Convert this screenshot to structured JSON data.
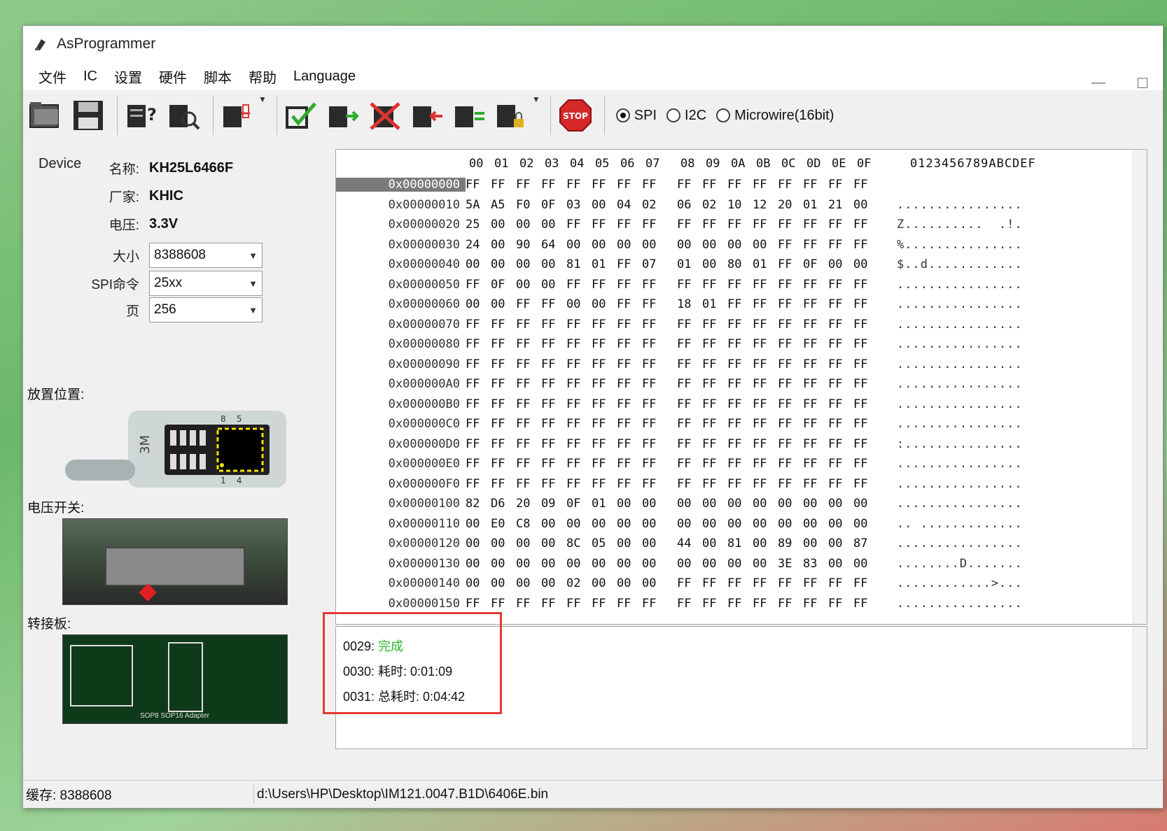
{
  "window": {
    "title": "AsProgrammer"
  },
  "menu": [
    "文件",
    "IC",
    "设置",
    "硬件",
    "脚本",
    "帮助",
    "Language"
  ],
  "toolbar": {
    "buttons": [
      "open-icon",
      "save-icon",
      "read-id-icon",
      "search-icon",
      "config-icon",
      "verify-icon",
      "read-icon",
      "erase-icon",
      "write-icon",
      "compare-icon",
      "lock-icon",
      "stop-icon"
    ],
    "stop_label": "STOP",
    "protocols": [
      {
        "label": "SPI",
        "selected": true
      },
      {
        "label": "I2C",
        "selected": false
      },
      {
        "label": "Microwire(16bit)",
        "selected": false
      }
    ]
  },
  "device": {
    "section_label": "Device",
    "name_label": "名称:",
    "name": "KH25L6466F",
    "vendor_label": "厂家:",
    "vendor": "KHIC",
    "voltage_label": "电压:",
    "voltage": "3.3V",
    "size_label": "大小",
    "size": "8388608",
    "spi_cmd_label": "SPI命令",
    "spi_cmd": "25xx",
    "page_label": "页",
    "page": "256"
  },
  "sections": {
    "placement": "放置位置:",
    "voltage_switch": "电压开关:",
    "adapter": "转接板:"
  },
  "chip_panel": {
    "pin_top": "8    5",
    "pin_bottom": "1    4",
    "text": "3M"
  },
  "photos": {
    "adapter_text": "SOP8  SOP16  Adapter"
  },
  "hex": {
    "header": [
      "00",
      "01",
      "02",
      "03",
      "04",
      "05",
      "06",
      "07",
      "08",
      "09",
      "0A",
      "0B",
      "0C",
      "0D",
      "0E",
      "0F"
    ],
    "ascii_header": "0123456789ABCDEF",
    "rows": [
      {
        "addr": "0x00000000",
        "bytes": [
          "FF",
          "FF",
          "FF",
          "FF",
          "FF",
          "FF",
          "FF",
          "FF",
          "FF",
          "FF",
          "FF",
          "FF",
          "FF",
          "FF",
          "FF",
          "FF"
        ],
        "ascii": ""
      },
      {
        "addr": "0x00000010",
        "bytes": [
          "5A",
          "A5",
          "F0",
          "0F",
          "03",
          "00",
          "04",
          "02",
          "06",
          "02",
          "10",
          "12",
          "20",
          "01",
          "21",
          "00"
        ],
        "ascii": "................"
      },
      {
        "addr": "0x00000020",
        "bytes": [
          "25",
          "00",
          "00",
          "00",
          "FF",
          "FF",
          "FF",
          "FF",
          "FF",
          "FF",
          "FF",
          "FF",
          "FF",
          "FF",
          "FF",
          "FF"
        ],
        "ascii": "Z..........  .!."
      },
      {
        "addr": "0x00000030",
        "bytes": [
          "24",
          "00",
          "90",
          "64",
          "00",
          "00",
          "00",
          "00",
          "00",
          "00",
          "00",
          "00",
          "FF",
          "FF",
          "FF",
          "FF"
        ],
        "ascii": "%..............."
      },
      {
        "addr": "0x00000040",
        "bytes": [
          "00",
          "00",
          "00",
          "00",
          "81",
          "01",
          "FF",
          "07",
          "01",
          "00",
          "80",
          "01",
          "FF",
          "0F",
          "00",
          "00"
        ],
        "ascii": "$..d............"
      },
      {
        "addr": "0x00000050",
        "bytes": [
          "FF",
          "0F",
          "00",
          "00",
          "FF",
          "FF",
          "FF",
          "FF",
          "FF",
          "FF",
          "FF",
          "FF",
          "FF",
          "FF",
          "FF",
          "FF"
        ],
        "ascii": "................"
      },
      {
        "addr": "0x00000060",
        "bytes": [
          "00",
          "00",
          "FF",
          "FF",
          "00",
          "00",
          "FF",
          "FF",
          "18",
          "01",
          "FF",
          "FF",
          "FF",
          "FF",
          "FF",
          "FF"
        ],
        "ascii": "................"
      },
      {
        "addr": "0x00000070",
        "bytes": [
          "FF",
          "FF",
          "FF",
          "FF",
          "FF",
          "FF",
          "FF",
          "FF",
          "FF",
          "FF",
          "FF",
          "FF",
          "FF",
          "FF",
          "FF",
          "FF"
        ],
        "ascii": "................"
      },
      {
        "addr": "0x00000080",
        "bytes": [
          "FF",
          "FF",
          "FF",
          "FF",
          "FF",
          "FF",
          "FF",
          "FF",
          "FF",
          "FF",
          "FF",
          "FF",
          "FF",
          "FF",
          "FF",
          "FF"
        ],
        "ascii": "................"
      },
      {
        "addr": "0x00000090",
        "bytes": [
          "FF",
          "FF",
          "FF",
          "FF",
          "FF",
          "FF",
          "FF",
          "FF",
          "FF",
          "FF",
          "FF",
          "FF",
          "FF",
          "FF",
          "FF",
          "FF"
        ],
        "ascii": "................"
      },
      {
        "addr": "0x000000A0",
        "bytes": [
          "FF",
          "FF",
          "FF",
          "FF",
          "FF",
          "FF",
          "FF",
          "FF",
          "FF",
          "FF",
          "FF",
          "FF",
          "FF",
          "FF",
          "FF",
          "FF"
        ],
        "ascii": "................"
      },
      {
        "addr": "0x000000B0",
        "bytes": [
          "FF",
          "FF",
          "FF",
          "FF",
          "FF",
          "FF",
          "FF",
          "FF",
          "FF",
          "FF",
          "FF",
          "FF",
          "FF",
          "FF",
          "FF",
          "FF"
        ],
        "ascii": "................"
      },
      {
        "addr": "0x000000C0",
        "bytes": [
          "FF",
          "FF",
          "FF",
          "FF",
          "FF",
          "FF",
          "FF",
          "FF",
          "FF",
          "FF",
          "FF",
          "FF",
          "FF",
          "FF",
          "FF",
          "FF"
        ],
        "ascii": "................"
      },
      {
        "addr": "0x000000D0",
        "bytes": [
          "FF",
          "FF",
          "FF",
          "FF",
          "FF",
          "FF",
          "FF",
          "FF",
          "FF",
          "FF",
          "FF",
          "FF",
          "FF",
          "FF",
          "FF",
          "FF"
        ],
        "ascii": ":..............."
      },
      {
        "addr": "0x000000E0",
        "bytes": [
          "FF",
          "FF",
          "FF",
          "FF",
          "FF",
          "FF",
          "FF",
          "FF",
          "FF",
          "FF",
          "FF",
          "FF",
          "FF",
          "FF",
          "FF",
          "FF"
        ],
        "ascii": "................"
      },
      {
        "addr": "0x000000F0",
        "bytes": [
          "FF",
          "FF",
          "FF",
          "FF",
          "FF",
          "FF",
          "FF",
          "FF",
          "FF",
          "FF",
          "FF",
          "FF",
          "FF",
          "FF",
          "FF",
          "FF"
        ],
        "ascii": "................"
      },
      {
        "addr": "0x00000100",
        "bytes": [
          "82",
          "D6",
          "20",
          "09",
          "0F",
          "01",
          "00",
          "00",
          "00",
          "00",
          "00",
          "00",
          "00",
          "00",
          "00",
          "00"
        ],
        "ascii": "................"
      },
      {
        "addr": "0x00000110",
        "bytes": [
          "00",
          "E0",
          "C8",
          "00",
          "00",
          "00",
          "00",
          "00",
          "00",
          "00",
          "00",
          "00",
          "00",
          "00",
          "00",
          "00"
        ],
        "ascii": ".. ............."
      },
      {
        "addr": "0x00000120",
        "bytes": [
          "00",
          "00",
          "00",
          "00",
          "8C",
          "05",
          "00",
          "00",
          "44",
          "00",
          "81",
          "00",
          "89",
          "00",
          "00",
          "87"
        ],
        "ascii": "................"
      },
      {
        "addr": "0x00000130",
        "bytes": [
          "00",
          "00",
          "00",
          "00",
          "00",
          "00",
          "00",
          "00",
          "00",
          "00",
          "00",
          "00",
          "3E",
          "83",
          "00",
          "00"
        ],
        "ascii": "........D......."
      },
      {
        "addr": "0x00000140",
        "bytes": [
          "00",
          "00",
          "00",
          "00",
          "02",
          "00",
          "00",
          "00",
          "FF",
          "FF",
          "FF",
          "FF",
          "FF",
          "FF",
          "FF",
          "FF"
        ],
        "ascii": "............>..."
      },
      {
        "addr": "0x00000150",
        "bytes": [
          "FF",
          "FF",
          "FF",
          "FF",
          "FF",
          "FF",
          "FF",
          "FF",
          "FF",
          "FF",
          "FF",
          "FF",
          "FF",
          "FF",
          "FF",
          "FF"
        ],
        "ascii": "................"
      }
    ]
  },
  "log": [
    {
      "prefix": "0029: ",
      "text": "完成",
      "status": "ok"
    },
    {
      "prefix": "0030: ",
      "text": "耗时: 0:01:09",
      "status": ""
    },
    {
      "prefix": "0031: ",
      "text": "总耗时: 0:04:42",
      "status": ""
    }
  ],
  "status": {
    "buffer": "缓存: 8388608",
    "file_path": "d:\\Users\\HP\\Desktop\\IM121.0047.B1D\\6406E.bin"
  },
  "colors": {
    "log_ok": "#2bb52b",
    "highlight_box": "#e53935",
    "selected_addr_bg": "#7a7a7a"
  }
}
